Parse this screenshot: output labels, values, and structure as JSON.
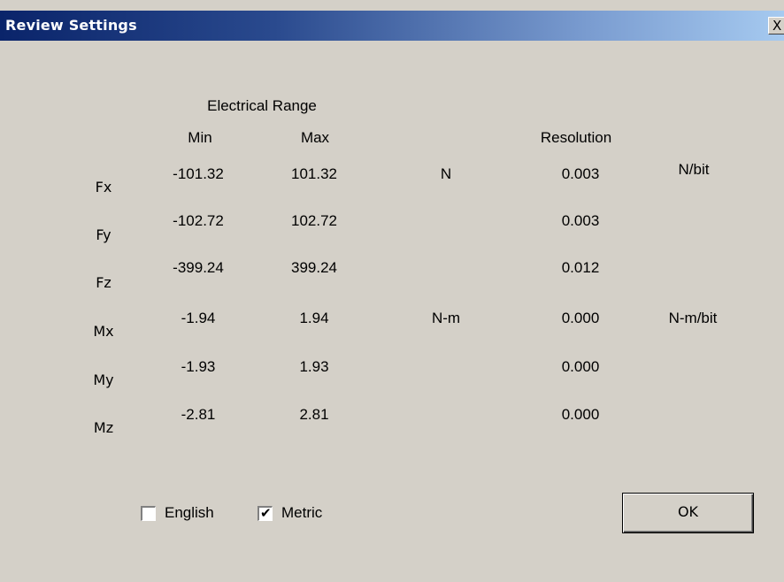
{
  "window": {
    "title": "Review Settings",
    "close_glyph": "X"
  },
  "headers": {
    "electrical_range": "Electrical Range",
    "min": "Min",
    "max": "Max",
    "resolution": "Resolution"
  },
  "rows": [
    {
      "axis": "Fx",
      "min": "-101.32",
      "max": "101.32",
      "unit": "N",
      "resolution": "0.003",
      "res_unit": "N/bit"
    },
    {
      "axis": "Fy",
      "min": "-102.72",
      "max": "102.72",
      "unit": "",
      "resolution": "0.003",
      "res_unit": ""
    },
    {
      "axis": "Fz",
      "min": "-399.24",
      "max": "399.24",
      "unit": "",
      "resolution": "0.012",
      "res_unit": ""
    },
    {
      "axis": "Mx",
      "min": "-1.94",
      "max": "1.94",
      "unit": "N-m",
      "resolution": "0.000",
      "res_unit": "N-m/bit"
    },
    {
      "axis": "My",
      "min": "-1.93",
      "max": "1.93",
      "unit": "",
      "resolution": "0.000",
      "res_unit": ""
    },
    {
      "axis": "Mz",
      "min": "-2.81",
      "max": "2.81",
      "unit": "",
      "resolution": "0.000",
      "res_unit": ""
    }
  ],
  "units": {
    "english": {
      "label": "English",
      "checked": false
    },
    "metric": {
      "label": "Metric",
      "checked": true,
      "check_glyph": "✔"
    }
  },
  "buttons": {
    "ok": "OK"
  }
}
